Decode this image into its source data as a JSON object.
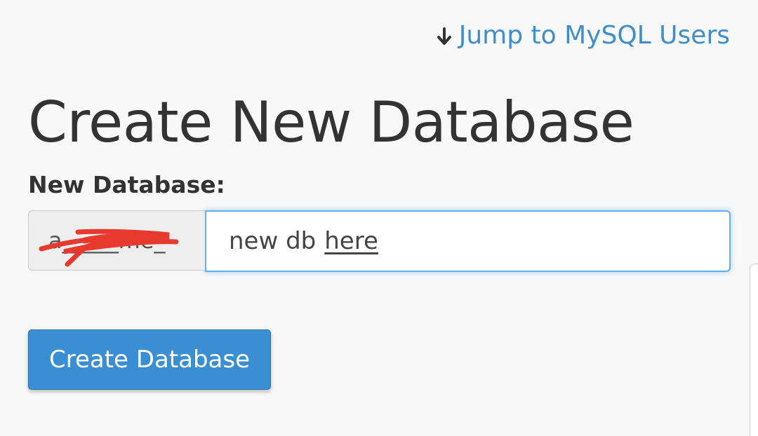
{
  "jump_link": {
    "label": "Jump to MySQL Users",
    "icon": "arrow-down-icon"
  },
  "page_title": "Create New Database",
  "new_database": {
    "label": "New Database:",
    "prefix": "a_____me_",
    "input_value_part1": "new db",
    "input_value_part2": "here"
  },
  "create_button": {
    "label": "Create Database"
  },
  "colors": {
    "link": "#3f8ec9",
    "button": "#3a8fd4",
    "focus_border": "#66afe9",
    "redaction": "#e8392e"
  }
}
